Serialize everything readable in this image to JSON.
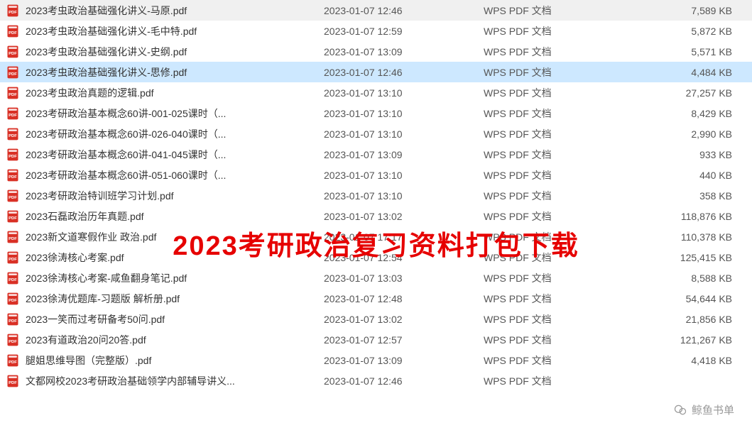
{
  "overlay": "2023考研政治复习资料打包下载",
  "watermark": "鲸鱼书单",
  "selectedIndex": 3,
  "files": [
    {
      "name": "2023考虫政治基础强化讲义-马原.pdf",
      "date": "2023-01-07 12:46",
      "type": "WPS PDF 文档",
      "size": "7,589 KB"
    },
    {
      "name": "2023考虫政治基础强化讲义-毛中特.pdf",
      "date": "2023-01-07 12:59",
      "type": "WPS PDF 文档",
      "size": "5,872 KB"
    },
    {
      "name": "2023考虫政治基础强化讲义-史纲.pdf",
      "date": "2023-01-07 13:09",
      "type": "WPS PDF 文档",
      "size": "5,571 KB"
    },
    {
      "name": "2023考虫政治基础强化讲义-思修.pdf",
      "date": "2023-01-07 12:46",
      "type": "WPS PDF 文档",
      "size": "4,484 KB"
    },
    {
      "name": "2023考虫政治真题的逻辑.pdf",
      "date": "2023-01-07 13:10",
      "type": "WPS PDF 文档",
      "size": "27,257 KB"
    },
    {
      "name": "2023考研政治基本概念60讲-001-025课时（...",
      "date": "2023-01-07 13:10",
      "type": "WPS PDF 文档",
      "size": "8,429 KB"
    },
    {
      "name": "2023考研政治基本概念60讲-026-040课时（...",
      "date": "2023-01-07 13:10",
      "type": "WPS PDF 文档",
      "size": "2,990 KB"
    },
    {
      "name": "2023考研政治基本概念60讲-041-045课时（...",
      "date": "2023-01-07 13:09",
      "type": "WPS PDF 文档",
      "size": "933 KB"
    },
    {
      "name": "2023考研政治基本概念60讲-051-060课时（...",
      "date": "2023-01-07 13:10",
      "type": "WPS PDF 文档",
      "size": "440 KB"
    },
    {
      "name": "2023考研政治特训班学习计划.pdf",
      "date": "2023-01-07 13:10",
      "type": "WPS PDF 文档",
      "size": "358 KB"
    },
    {
      "name": "2023石磊政治历年真题.pdf",
      "date": "2023-01-07 13:02",
      "type": "WPS PDF 文档",
      "size": "118,876 KB"
    },
    {
      "name": "2023新文道寒假作业 政治.pdf",
      "date": "2023-01-07 17:17",
      "type": "WPS PDF 文档",
      "size": "110,378 KB"
    },
    {
      "name": "2023徐涛核心考案.pdf",
      "date": "2023-01-07 12:54",
      "type": "WPS PDF 文档",
      "size": "125,415 KB"
    },
    {
      "name": "2023徐涛核心考案-咸鱼翻身笔记.pdf",
      "date": "2023-01-07 13:03",
      "type": "WPS PDF 文档",
      "size": "8,588 KB"
    },
    {
      "name": "2023徐涛优题库-习题版 解析册.pdf",
      "date": "2023-01-07 12:48",
      "type": "WPS PDF 文档",
      "size": "54,644 KB"
    },
    {
      "name": "2023一笑而过考研备考50问.pdf",
      "date": "2023-01-07 13:02",
      "type": "WPS PDF 文档",
      "size": "21,856 KB"
    },
    {
      "name": "2023有道政治20问20答.pdf",
      "date": "2023-01-07 12:57",
      "type": "WPS PDF 文档",
      "size": "121,267 KB"
    },
    {
      "name": "腿姐思维导图（完整版）.pdf",
      "date": "2023-01-07 13:09",
      "type": "WPS PDF 文档",
      "size": "4,418 KB"
    },
    {
      "name": "文都网校2023考研政治基础领学内部辅导讲义...",
      "date": "2023-01-07 12:46",
      "type": "WPS PDF 文档",
      "size": ""
    }
  ]
}
